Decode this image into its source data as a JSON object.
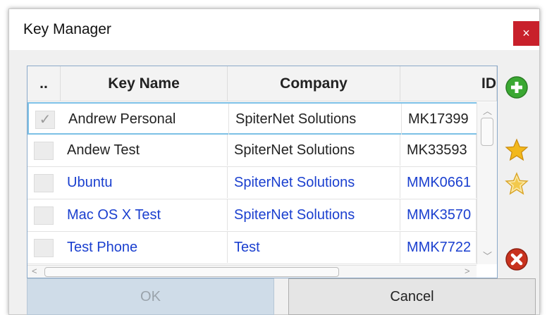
{
  "window": {
    "title": "Key Manager",
    "close_label": "×"
  },
  "grid": {
    "columns": {
      "check": "..",
      "name": "Key Name",
      "company": "Company",
      "id": "ID"
    },
    "rows": [
      {
        "checked": true,
        "check_glyph": "✓",
        "name": "Andrew Personal",
        "company": "SpiterNet Solutions",
        "id": "MK17399",
        "color": "#222222"
      },
      {
        "checked": false,
        "check_glyph": "",
        "name": "Andew Test",
        "company": "SpiterNet Solutions",
        "id": "MK33593",
        "color": "#222222"
      },
      {
        "checked": false,
        "check_glyph": "",
        "name": "Ubuntu",
        "company": "SpiterNet Solutions",
        "id": "MMK0661",
        "color": "#1a3fcf"
      },
      {
        "checked": false,
        "check_glyph": "",
        "name": "Mac OS X Test",
        "company": "SpiterNet Solutions",
        "id": "MMK3570",
        "color": "#1a3fcf"
      },
      {
        "checked": false,
        "check_glyph": "",
        "name": "Test Phone",
        "company": "Test",
        "id": "MMK7722",
        "color": "#1a3fcf"
      }
    ]
  },
  "side_actions": [
    {
      "icon": "add-icon",
      "color": "#3aa832"
    },
    {
      "icon": "star-icon",
      "color": "#f2b81c"
    },
    {
      "icon": "star-outline-icon",
      "color": "#f2c94c"
    },
    {
      "icon": "remove-icon",
      "color": "#c8321e"
    }
  ],
  "buttons": {
    "ok": "OK",
    "cancel": "Cancel"
  }
}
